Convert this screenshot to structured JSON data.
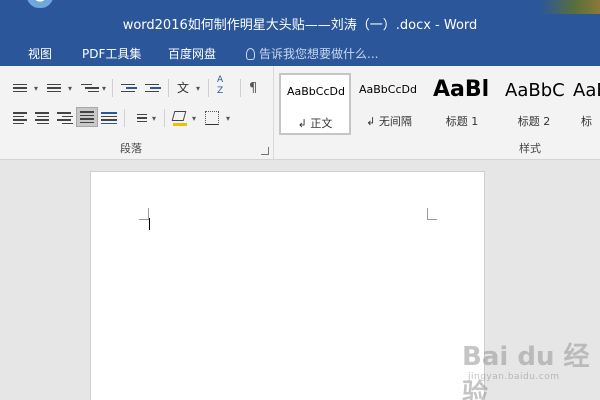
{
  "window": {
    "title": "word2016如何制作明星大头贴——刘涛（一）.docx - Word"
  },
  "tabs": [
    {
      "label": "视图"
    },
    {
      "label": "PDF工具集"
    },
    {
      "label": "百度网盘"
    }
  ],
  "tell_me": {
    "placeholder": "告诉我您想要做什么..."
  },
  "paragraph_group": {
    "label": "段落"
  },
  "styles_group": {
    "label": "样式",
    "items": [
      {
        "sample": "AaBbCcDd",
        "name": "↲ 正文"
      },
      {
        "sample": "AaBbCcDd",
        "name": "↲ 无间隔"
      },
      {
        "sample": "AaBl",
        "name": "标题 1"
      },
      {
        "sample": "AaBbC",
        "name": "标题 2"
      },
      {
        "sample": "AaB",
        "name": "标"
      }
    ]
  },
  "watermark": {
    "main": "Bai du 经验",
    "sub": "jingyan.baidu.com"
  },
  "colors": {
    "ribbon_blue": "#2b579a",
    "ribbon_bg": "#f3f3f3",
    "doc_bg": "#e6e6e6"
  }
}
